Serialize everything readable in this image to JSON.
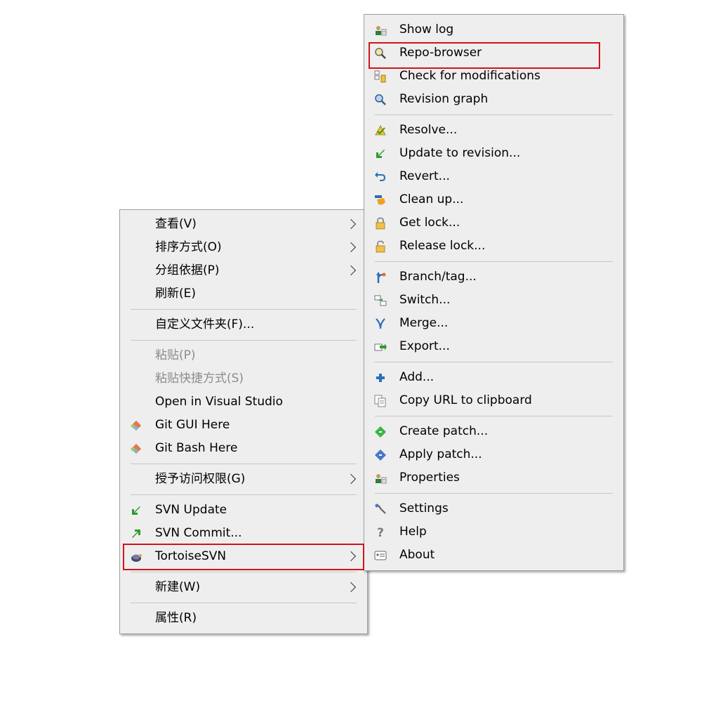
{
  "main_menu": {
    "view": "查看(V)",
    "sort_by": "排序方式(O)",
    "group_by": "分组依据(P)",
    "refresh": "刷新(E)",
    "customize_folder": "自定义文件夹(F)...",
    "paste": "粘贴(P)",
    "paste_shortcut": "粘贴快捷方式(S)",
    "open_vs": "Open in Visual Studio",
    "git_gui": "Git GUI Here",
    "git_bash": "Git Bash Here",
    "grant_access": "授予访问权限(G)",
    "svn_update": "SVN Update",
    "svn_commit": "SVN Commit...",
    "tortoise_svn": "TortoiseSVN",
    "new": "新建(W)",
    "properties": "属性(R)"
  },
  "sub_menu": {
    "show_log": "Show log",
    "repo_browser": "Repo-browser",
    "check_mods": "Check for modifications",
    "revision_graph": "Revision graph",
    "resolve": "Resolve...",
    "update_to_revision": "Update to revision...",
    "revert": "Revert...",
    "clean_up": "Clean up...",
    "get_lock": "Get lock...",
    "release_lock": "Release lock...",
    "branch_tag": "Branch/tag...",
    "switch": "Switch...",
    "merge": "Merge...",
    "export": "Export...",
    "add": "Add...",
    "copy_url": "Copy URL to clipboard",
    "create_patch": "Create patch...",
    "apply_patch": "Apply patch...",
    "properties": "Properties",
    "settings": "Settings",
    "help": "Help",
    "about": "About"
  },
  "colors": {
    "menu_bg": "#eeeeee",
    "highlight_border": "#d1141b",
    "disabled_text": "#8c8c8c"
  }
}
